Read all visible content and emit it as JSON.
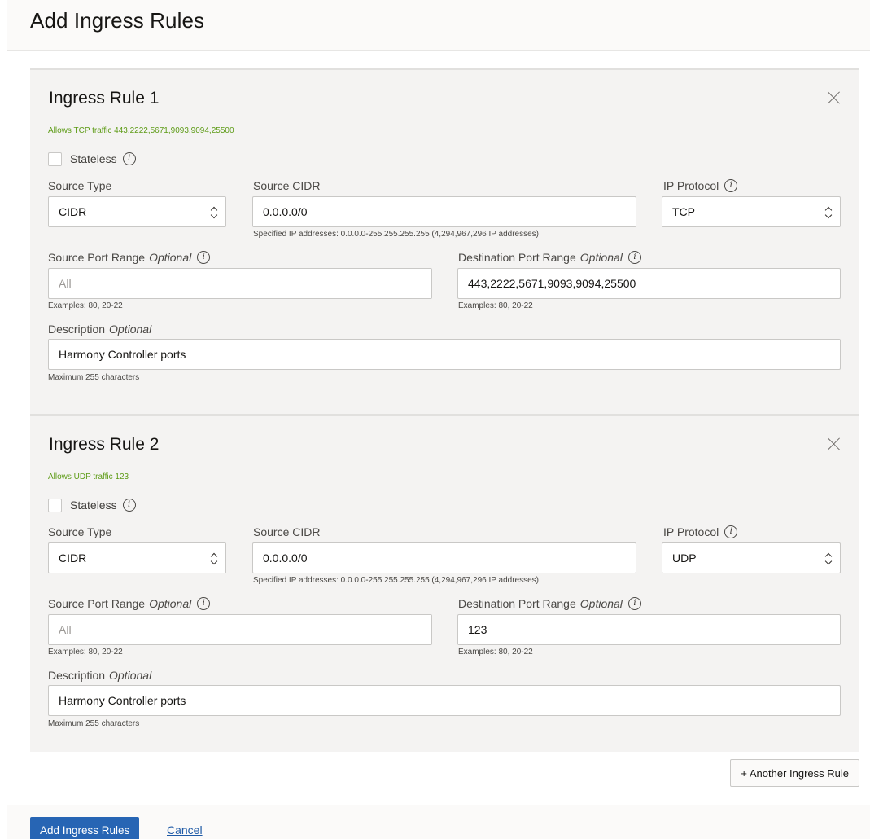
{
  "panel": {
    "title": "Add Ingress Rules"
  },
  "rules": [
    {
      "title": "Ingress Rule 1",
      "allows": "Allows TCP traffic 443,2222,5671,9093,9094,25500",
      "stateless_label": "Stateless",
      "stateless_checked": false,
      "source_type_label": "Source Type",
      "source_type_value": "CIDR",
      "source_cidr_label": "Source CIDR",
      "source_cidr_value": "0.0.0.0/0",
      "source_cidr_help": "Specified IP addresses: 0.0.0.0-255.255.255.255 (4,294,967,296 IP addresses)",
      "ip_protocol_label": "IP Protocol",
      "ip_protocol_value": "TCP",
      "source_port_label": "Source Port Range",
      "source_port_placeholder": "All",
      "source_port_help": "Examples: 80, 20-22",
      "dest_port_label": "Destination Port Range",
      "dest_port_value": "443,2222,5671,9093,9094,25500",
      "dest_port_help": "Examples: 80, 20-22",
      "optional_label": "Optional",
      "description_label": "Description",
      "description_value": "Harmony Controller ports",
      "description_help": "Maximum 255 characters"
    },
    {
      "title": "Ingress Rule 2",
      "allows": "Allows UDP traffic 123",
      "stateless_label": "Stateless",
      "stateless_checked": false,
      "source_type_label": "Source Type",
      "source_type_value": "CIDR",
      "source_cidr_label": "Source CIDR",
      "source_cidr_value": "0.0.0.0/0",
      "source_cidr_help": "Specified IP addresses: 0.0.0.0-255.255.255.255 (4,294,967,296 IP addresses)",
      "ip_protocol_label": "IP Protocol",
      "ip_protocol_value": "UDP",
      "source_port_label": "Source Port Range",
      "source_port_placeholder": "All",
      "source_port_help": "Examples: 80, 20-22",
      "dest_port_label": "Destination Port Range",
      "dest_port_value": "123",
      "dest_port_help": "Examples: 80, 20-22",
      "optional_label": "Optional",
      "description_label": "Description",
      "description_value": "Harmony Controller ports",
      "description_help": "Maximum 255 characters"
    }
  ],
  "buttons": {
    "another_rule": "+ Another Ingress Rule",
    "submit": "Add Ingress Rules",
    "cancel": "Cancel"
  },
  "icons": {
    "info": "i",
    "close": "close-icon",
    "select_chevron": "chevron-up-down-icon"
  },
  "colors": {
    "primary": "#2765b4",
    "allows_text": "#5d9b16",
    "link": "#1f5aa6",
    "card_bg": "#f4f3f2"
  }
}
